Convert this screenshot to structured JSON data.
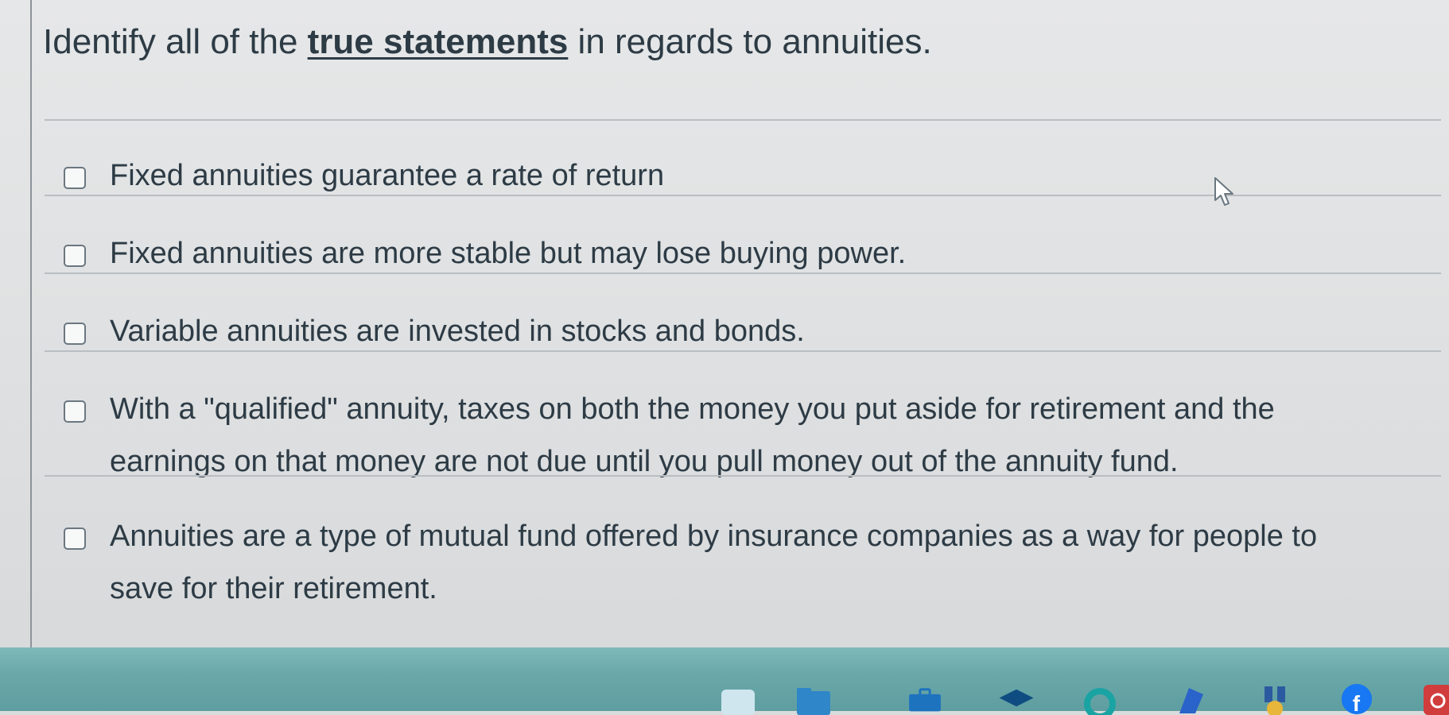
{
  "question": {
    "prefix": "Identify all of the ",
    "emphasis": "true statements",
    "suffix": " in regards to annuities."
  },
  "answers": [
    {
      "label": "Fixed annuities guarantee a rate of return",
      "checked": false
    },
    {
      "label": "Fixed annuities are more stable but may lose buying power.",
      "checked": false
    },
    {
      "label": "Variable annuities are invested in stocks and bonds.",
      "checked": false
    },
    {
      "label": "With a \"qualified\" annuity, taxes on both the money you put aside for retirement and the earnings on that money are not due until you pull money out of the annuity fund.",
      "checked": false
    },
    {
      "label": "Annuities are a type of mutual fund offered by insurance companies as a way for people to save for their retirement.",
      "checked": false
    }
  ],
  "taskbar": {
    "icons": [
      "app-icon",
      "folder-icon",
      "briefcase-icon",
      "graduation-cap-icon",
      "circle-app-icon",
      "copilot-icon",
      "medal-icon",
      "facebook-icon",
      "settings-icon"
    ],
    "accent": "#5f9ea0"
  },
  "colors": {
    "text": "#2d3b45",
    "background": "#e4e5e6"
  }
}
